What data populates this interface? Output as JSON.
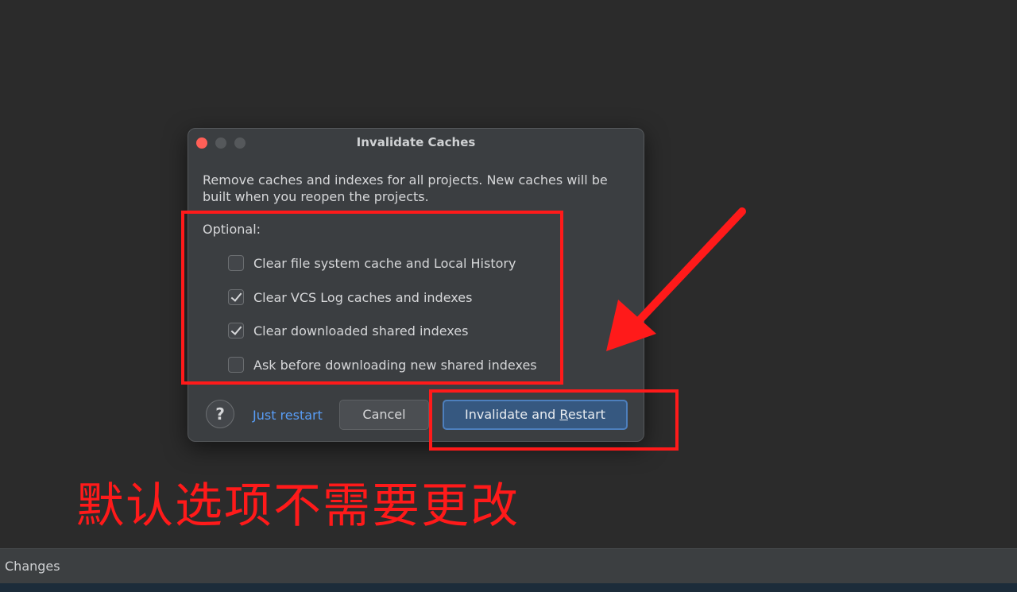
{
  "dialog": {
    "title": "Invalidate Caches",
    "description": "Remove caches and indexes for all projects. New caches will be built when you reopen the projects.",
    "optional_label": "Optional:",
    "options": [
      {
        "label": "Clear file system cache and Local History",
        "checked": false
      },
      {
        "label": "Clear VCS Log caches and indexes",
        "checked": true
      },
      {
        "label": "Clear downloaded shared indexes",
        "checked": true
      },
      {
        "label": "Ask before downloading new shared indexes",
        "checked": false
      }
    ],
    "help_symbol": "?",
    "just_restart_label": "Just restart",
    "cancel_label": "Cancel",
    "primary_label_before": "Invalidate and ",
    "primary_label_mnemonic": "R",
    "primary_label_after": "estart"
  },
  "annotation": {
    "text": "默认选项不需要更改",
    "color": "#ff1a1a"
  },
  "bottom_bar": {
    "tool_window_label": "Changes"
  },
  "colors": {
    "background": "#2b2b2b",
    "dialog_bg": "#3b3e41",
    "link": "#589df6",
    "primary_button": "#365880",
    "close_button": "#ff5f57"
  }
}
